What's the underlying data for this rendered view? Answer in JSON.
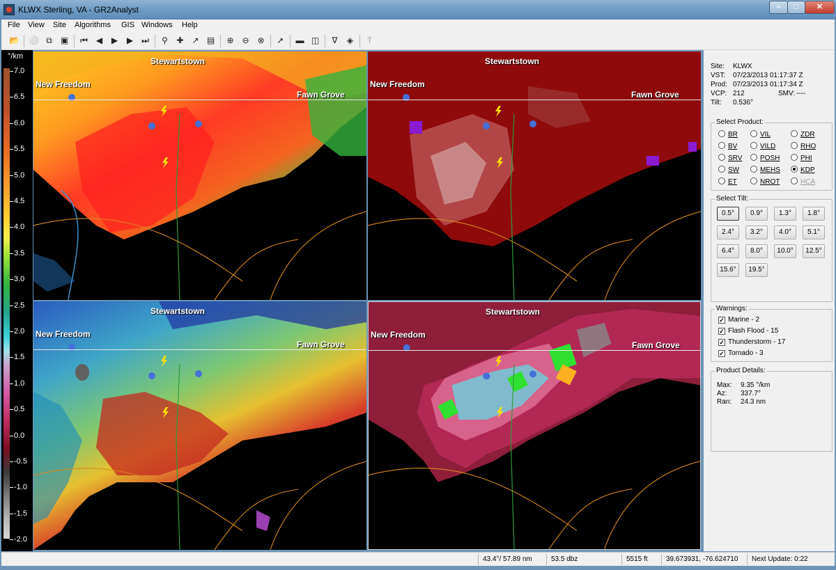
{
  "window": {
    "title": "KLWX Sterling, VA - GR2Analyst"
  },
  "menu": [
    "File",
    "View",
    "Site",
    "Algorithms",
    "GIS",
    "Windows",
    "Help"
  ],
  "toolbar_icons": [
    "open-icon",
    "connect-icon",
    "copy-icon",
    "layers-icon",
    "skip-back-icon",
    "step-back-icon",
    "play-icon",
    "step-forward-icon",
    "skip-forward-icon",
    "zoom-icon",
    "pan-icon",
    "measure-icon",
    "clipboard-icon",
    "zoom-in-icon",
    "zoom-out-icon",
    "zoom-reset-icon",
    "arrow-icon",
    "single-pane-icon",
    "dual-pane-icon",
    "filter-icon",
    "diamond-icon",
    "text-icon"
  ],
  "colorbar": {
    "unit": "°/km",
    "labels": [
      "7.0",
      "6.5",
      "6.0",
      "5.5",
      "5.0",
      "4.5",
      "4.0",
      "3.5",
      "3.0",
      "2.5",
      "2.0",
      "1.5",
      "1.0",
      "0.5",
      "0.0",
      "-0.5",
      "-1.0",
      "-1.5",
      "-2.0"
    ]
  },
  "map": {
    "towns": {
      "stewartstown": "Stewartstown",
      "new_freedom": "New Freedom",
      "fawn_grove": "Fawn Grove"
    }
  },
  "site_info": {
    "site_label": "Site:",
    "site": "KLWX",
    "vst_label": "VST:",
    "vst": "07/23/2013  01:17:37 Z",
    "prod_label": "Prod:",
    "prod": "07/23/2013  01:17:34 Z",
    "vcp_label": "VCP:",
    "vcp": "212",
    "smv_label": "SMV:",
    "smv": "----",
    "tilt_label": "Tilt:",
    "tilt": "0.536°"
  },
  "select_product": {
    "title": "Select Product:",
    "products": [
      "BR",
      "VIL",
      "ZDR",
      "BV",
      "VILD",
      "RHO",
      "SRV",
      "POSH",
      "PHI",
      "SW",
      "MEHS",
      "KDP",
      "ET",
      "NROT",
      "HCA"
    ],
    "selected": "KDP",
    "disabled": "HCA"
  },
  "select_tilt": {
    "title": "Select Tilt:",
    "tilts": [
      "0.5°",
      "0.9°",
      "1.3°",
      "1.8°",
      "2.4°",
      "3.2°",
      "4.0°",
      "5.1°",
      "6.4°",
      "8.0°",
      "10.0°",
      "12.5°",
      "15.6°",
      "19.5°"
    ],
    "selected": "0.5°"
  },
  "warnings": {
    "title": "Warnings:",
    "items": [
      {
        "label": "Marine - 2",
        "checked": true
      },
      {
        "label": "Flash Flood - 15",
        "checked": true
      },
      {
        "label": "Thunderstorm - 17",
        "checked": true
      },
      {
        "label": "Tornado - 3",
        "checked": true
      }
    ]
  },
  "product_details": {
    "title": "Product Details:",
    "max_label": "Max:",
    "max": "9.35 °/km",
    "az_label": "Az:",
    "az": "337.7°",
    "ran_label": "Ran:",
    "ran": "24.3 nm"
  },
  "status": {
    "bearing": "43.4°/ 57.89 nm",
    "value": "53.5 dbz",
    "height": "5515 ft",
    "coords": "39.673931, -76.624710",
    "next_update": "Next Update: 0:22"
  }
}
